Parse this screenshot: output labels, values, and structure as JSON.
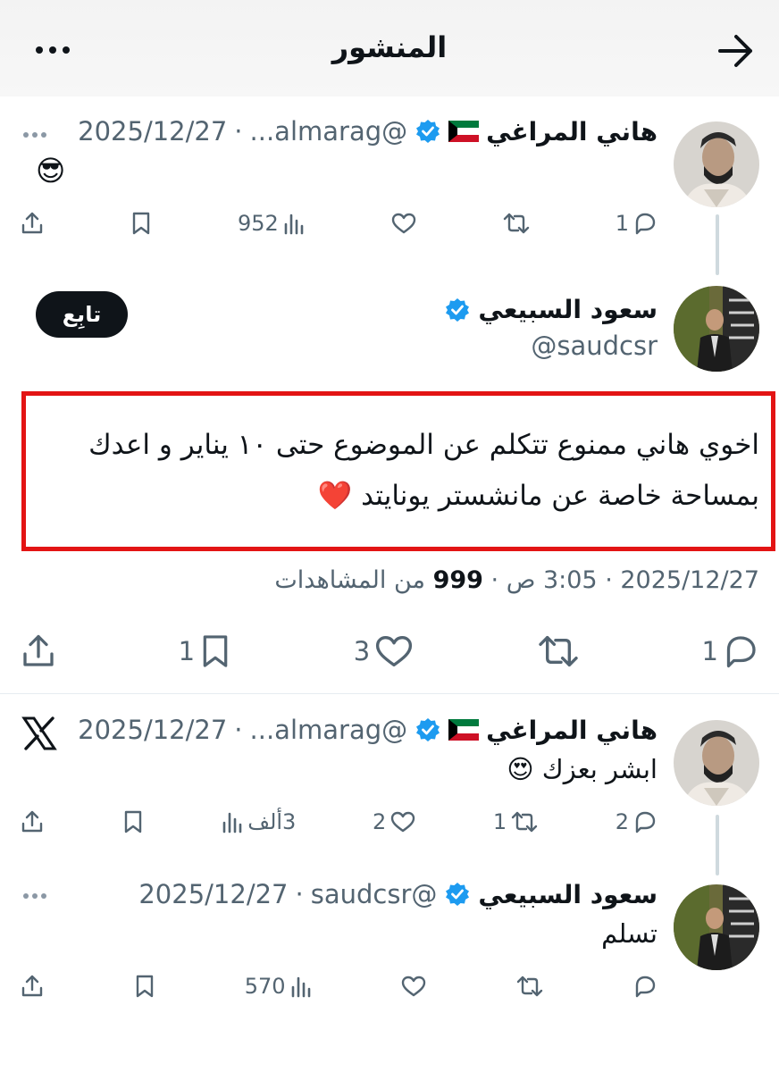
{
  "header": {
    "title": "المنشور"
  },
  "icons": {
    "back": "arrow-right-icon",
    "more": "more-dots-icon",
    "verified": "verified-badge-icon",
    "flag": "kuwait-flag-icon",
    "x_logo": "x-logo-icon"
  },
  "colors": {
    "verified": "#1d9bf0",
    "red_highlight": "#e31414",
    "text_secondary": "#536471"
  },
  "tweet1": {
    "name": "هاني المراغي",
    "handle": "@almarag...",
    "sep": "·",
    "date": "2025/12/27",
    "text": "😎",
    "replies": "1",
    "likes": "",
    "views": "952"
  },
  "main_tweet": {
    "name": "سعود السبيعي",
    "handle": "@saudcsr",
    "follow_label": "تابِع",
    "text_line1": "اخوي هاني ممنوع تتكلم عن الموضوع حتى ١٠ يناير و اعدك",
    "text_line2": "بمساحة خاصة عن مانشستر يونايتد ❤️",
    "time_date": "2025/12/27",
    "time_sep": "·",
    "time": "3:05 ص",
    "time_sep2": "·",
    "views_count": "999",
    "views_label": "من المشاهدات",
    "replies": "1",
    "likes": "3",
    "bookmarks": "1"
  },
  "tweet3": {
    "name": "هاني المراغي",
    "handle": "@almarag...",
    "sep": "·",
    "date": "2025/12/27",
    "text": "ابشر بعزك 😍",
    "replies": "2",
    "retweets": "1",
    "likes": "2",
    "views": "3ألف"
  },
  "tweet4": {
    "name": "سعود السبيعي",
    "handle": "@saudcsr",
    "sep": "·",
    "date": "2025/12/27",
    "text": "تسلم",
    "views": "570"
  }
}
